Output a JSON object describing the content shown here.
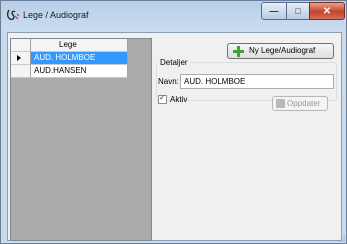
{
  "window": {
    "title": "Lege / Audiograf",
    "controls": {
      "minimize": "—",
      "maximize": "□",
      "close": "✕"
    }
  },
  "grid": {
    "header": "Lege",
    "rows": [
      {
        "name": "AUD. HOLMBOE",
        "selected": true
      },
      {
        "name": "AUD.HANSEN",
        "selected": false
      }
    ]
  },
  "toolbar": {
    "new_label": "Ny Lege/Audiograf"
  },
  "details": {
    "group_title": "Detaljer",
    "name_label": "Navn:",
    "name_value": "AUD. HOLMBOE",
    "active_label": "Aktiv",
    "active_checked": true,
    "update_label": "Oppdater"
  },
  "colors": {
    "selection": "#3399ff",
    "grid_background": "#ababab",
    "close_button": "#c3442a"
  },
  "icons": [
    "app-icon",
    "plus-icon",
    "update-icon",
    "current-row-arrow-icon",
    "resize-grip-icon"
  ]
}
